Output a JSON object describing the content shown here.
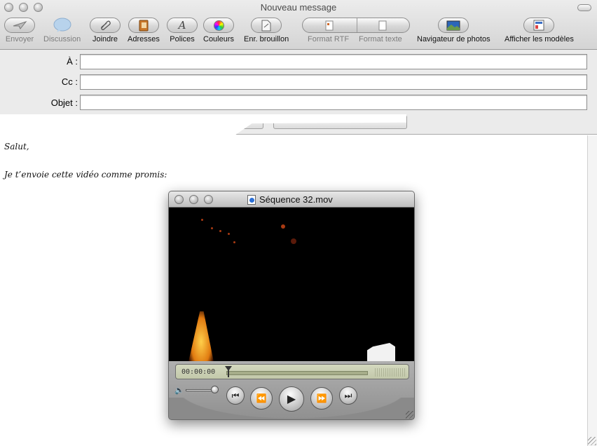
{
  "window": {
    "title": "Nouveau message"
  },
  "toolbar": {
    "send": "Envoyer",
    "chat": "Discussion",
    "attach": "Joindre",
    "address": "Adresses",
    "fonts": "Polices",
    "colors": "Couleurs",
    "save_draft": "Enr. brouillon",
    "rich_text": "Format RTF",
    "plain_text": "Format texte",
    "photo_browser": "Navigateur de photos",
    "stationery": "Afficher les modèles"
  },
  "headers": {
    "to_label": "À :",
    "to_value": "",
    "cc_label": "Cc :",
    "cc_value": "",
    "subject_label": "Objet :",
    "subject_value": ""
  },
  "body": {
    "greeting": "Salut,",
    "line": "Je t’envoie cette vidéo comme promis:"
  },
  "movie": {
    "title": "Séquence 32.mov",
    "timecode": "00:00:00",
    "progress": 0.0
  }
}
